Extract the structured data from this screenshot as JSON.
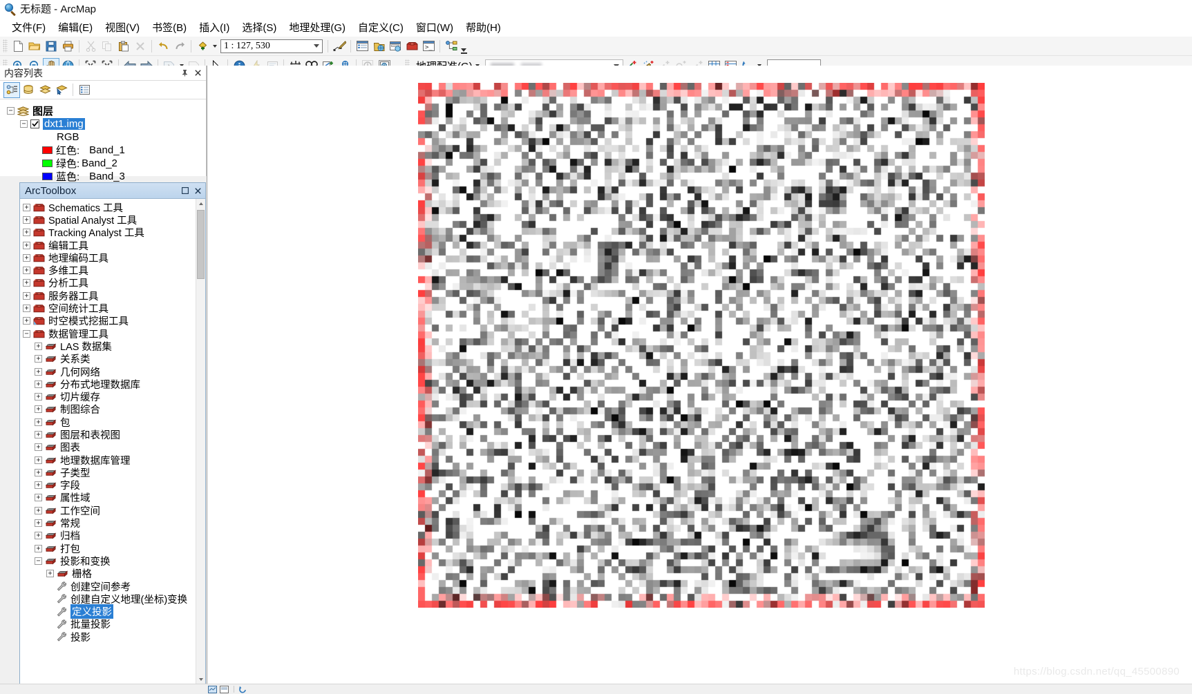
{
  "window": {
    "title": "无标题 - ArcMap",
    "app_icon": "arcmap-globe-icon"
  },
  "menu": {
    "items": [
      {
        "label": "文件(F)"
      },
      {
        "label": "编辑(E)"
      },
      {
        "label": "视图(V)"
      },
      {
        "label": "书签(B)"
      },
      {
        "label": "插入(I)"
      },
      {
        "label": "选择(S)"
      },
      {
        "label": "地理处理(G)"
      },
      {
        "label": "自定义(C)"
      },
      {
        "label": "窗口(W)"
      },
      {
        "label": "帮助(H)"
      }
    ]
  },
  "standard_toolbar": {
    "scale": "1 : 127, 530",
    "scale_placeholder": "1 : 127, 530",
    "buttons": [
      {
        "name": "new-map-icon",
        "tip": "新建地图文档"
      },
      {
        "name": "open-icon",
        "tip": "打开"
      },
      {
        "name": "save-icon",
        "tip": "保存"
      },
      {
        "name": "print-icon",
        "tip": "打印"
      },
      {
        "name": "cut-icon",
        "tip": "剪切"
      },
      {
        "name": "copy-icon",
        "tip": "复制"
      },
      {
        "name": "paste-icon",
        "tip": "粘贴"
      },
      {
        "name": "delete-icon",
        "tip": "删除"
      },
      {
        "name": "undo-icon",
        "tip": "撤销"
      },
      {
        "name": "redo-icon",
        "tip": "重做"
      },
      {
        "name": "add-data-icon",
        "tip": "添加数据"
      },
      {
        "name": "editor-toolbar-icon",
        "tip": "编辑器工具条"
      },
      {
        "name": "table-of-contents-icon",
        "tip": "内容列表"
      },
      {
        "name": "catalog-icon",
        "tip": "目录"
      },
      {
        "name": "search-window-icon",
        "tip": "搜索"
      },
      {
        "name": "arctoolbox-icon",
        "tip": "ArcToolbox"
      },
      {
        "name": "python-window-icon",
        "tip": "Python 窗口"
      },
      {
        "name": "model-builder-icon",
        "tip": "模型构建器"
      }
    ]
  },
  "tools_toolbar": {
    "buttons": [
      {
        "name": "zoom-in-icon",
        "tip": "放大"
      },
      {
        "name": "zoom-out-icon",
        "tip": "缩小"
      },
      {
        "name": "pan-icon",
        "tip": "平移",
        "active": true
      },
      {
        "name": "full-extent-icon",
        "tip": "全图范围"
      },
      {
        "name": "fixed-zoom-in-icon",
        "tip": "固定比例放大"
      },
      {
        "name": "fixed-zoom-out-icon",
        "tip": "固定比例缩小"
      },
      {
        "name": "go-back-icon",
        "tip": "返回上一视图"
      },
      {
        "name": "go-forward-icon",
        "tip": "前进至下一视图"
      },
      {
        "name": "select-features-icon",
        "tip": "选择要素"
      },
      {
        "name": "clear-selection-icon",
        "tip": "清除所选要素"
      },
      {
        "name": "select-elements-icon",
        "tip": "选择元素"
      },
      {
        "name": "identify-icon",
        "tip": "识别"
      },
      {
        "name": "hyperlink-icon",
        "tip": "超链接"
      },
      {
        "name": "html-popup-icon",
        "tip": "HTML 弹出窗口"
      },
      {
        "name": "measure-icon",
        "tip": "测量"
      },
      {
        "name": "find-icon",
        "tip": "查找"
      },
      {
        "name": "find-route-icon",
        "tip": "查找路径"
      },
      {
        "name": "go-to-xy-icon",
        "tip": "转到 XY"
      },
      {
        "name": "time-slider-icon",
        "tip": "时间滑块"
      },
      {
        "name": "create-viewer-icon",
        "tip": "创建视图窗口"
      }
    ]
  },
  "georeferencing_toolbar": {
    "menu_label": "地理配准(G)",
    "layer_value": "",
    "buttons": [
      {
        "name": "add-control-points-icon",
        "tip": "添加控制点"
      },
      {
        "name": "auto-register-icon",
        "tip": "自动配准"
      },
      {
        "name": "delete-control-point-icon",
        "tip": "删除控制点",
        "disabled": true
      },
      {
        "name": "zoom-to-link-icon",
        "tip": "缩放至链接",
        "disabled": true
      },
      {
        "name": "clear-links-icon",
        "tip": "清除链接",
        "disabled": true
      },
      {
        "name": "view-link-table-icon",
        "tip": "查看链接表"
      },
      {
        "name": "link-table-icon",
        "tip": "链接表"
      },
      {
        "name": "rotate-icon",
        "tip": "旋转"
      }
    ],
    "rotation_value": ""
  },
  "toc": {
    "title": "内容列表",
    "pin_icon": "pin-icon",
    "close_icon": "close-icon",
    "toolbar": [
      {
        "name": "list-by-drawing-order-icon",
        "active": true
      },
      {
        "name": "list-by-source-icon",
        "active": false
      },
      {
        "name": "list-by-visibility-icon",
        "active": false
      },
      {
        "name": "list-by-selection-icon",
        "active": false
      },
      {
        "name": "options-icon",
        "active": false
      }
    ],
    "root": {
      "label": "图层",
      "icon": "layers-icon"
    },
    "layer": {
      "label": "dxt1.img",
      "selected": true,
      "checked": true,
      "renderer": "RGB",
      "bands": [
        {
          "color_label": "红色:",
          "band": "Band_1",
          "color": "#ff0000"
        },
        {
          "color_label": "绿色:",
          "band": "Band_2",
          "color": "#00ff00"
        },
        {
          "color_label": "蓝色:",
          "band": "Band_3",
          "color": "#0000ff"
        }
      ]
    }
  },
  "arctoolbox": {
    "title": "ArcToolbox",
    "restore_icon": "restore-icon",
    "close_icon": "close-icon",
    "tree": [
      {
        "label": "Schematics 工具",
        "indent": 0,
        "expander": "+",
        "icon": "toolbox-icon"
      },
      {
        "label": "Spatial Analyst 工具",
        "indent": 0,
        "expander": "+",
        "icon": "toolbox-icon"
      },
      {
        "label": "Tracking Analyst 工具",
        "indent": 0,
        "expander": "+",
        "icon": "toolbox-icon"
      },
      {
        "label": "编辑工具",
        "indent": 0,
        "expander": "+",
        "icon": "toolbox-icon"
      },
      {
        "label": "地理编码工具",
        "indent": 0,
        "expander": "+",
        "icon": "toolbox-icon"
      },
      {
        "label": "多维工具",
        "indent": 0,
        "expander": "+",
        "icon": "toolbox-icon"
      },
      {
        "label": "分析工具",
        "indent": 0,
        "expander": "+",
        "icon": "toolbox-icon"
      },
      {
        "label": "服务器工具",
        "indent": 0,
        "expander": "+",
        "icon": "toolbox-icon"
      },
      {
        "label": "空间统计工具",
        "indent": 0,
        "expander": "+",
        "icon": "toolbox-icon"
      },
      {
        "label": "时空模式挖掘工具",
        "indent": 0,
        "expander": "+",
        "icon": "toolbox-blue-icon"
      },
      {
        "label": "数据管理工具",
        "indent": 0,
        "expander": "-",
        "icon": "toolbox-icon"
      },
      {
        "label": "LAS 数据集",
        "indent": 1,
        "expander": "+",
        "icon": "toolset-icon"
      },
      {
        "label": "关系类",
        "indent": 1,
        "expander": "+",
        "icon": "toolset-icon"
      },
      {
        "label": "几何网络",
        "indent": 1,
        "expander": "+",
        "icon": "toolset-icon"
      },
      {
        "label": "分布式地理数据库",
        "indent": 1,
        "expander": "+",
        "icon": "toolset-icon"
      },
      {
        "label": "切片缓存",
        "indent": 1,
        "expander": "+",
        "icon": "toolset-icon"
      },
      {
        "label": "制图综合",
        "indent": 1,
        "expander": "+",
        "icon": "toolset-icon"
      },
      {
        "label": "包",
        "indent": 1,
        "expander": "+",
        "icon": "toolset-icon"
      },
      {
        "label": "图层和表视图",
        "indent": 1,
        "expander": "+",
        "icon": "toolset-icon"
      },
      {
        "label": "图表",
        "indent": 1,
        "expander": "+",
        "icon": "toolset-icon"
      },
      {
        "label": "地理数据库管理",
        "indent": 1,
        "expander": "+",
        "icon": "toolset-icon"
      },
      {
        "label": "子类型",
        "indent": 1,
        "expander": "+",
        "icon": "toolset-icon"
      },
      {
        "label": "字段",
        "indent": 1,
        "expander": "+",
        "icon": "toolset-icon"
      },
      {
        "label": "属性域",
        "indent": 1,
        "expander": "+",
        "icon": "toolset-icon"
      },
      {
        "label": "工作空间",
        "indent": 1,
        "expander": "+",
        "icon": "toolset-icon"
      },
      {
        "label": "常规",
        "indent": 1,
        "expander": "+",
        "icon": "toolset-icon"
      },
      {
        "label": "归档",
        "indent": 1,
        "expander": "+",
        "icon": "toolset-icon"
      },
      {
        "label": "打包",
        "indent": 1,
        "expander": "+",
        "icon": "toolset-icon"
      },
      {
        "label": "投影和变换",
        "indent": 1,
        "expander": "-",
        "icon": "toolset-icon"
      },
      {
        "label": "栅格",
        "indent": 2,
        "expander": "+",
        "icon": "toolset-icon"
      },
      {
        "label": "创建空间参考",
        "indent": 2,
        "expander": "",
        "icon": "tool-icon"
      },
      {
        "label": "创建自定义地理(坐标)变换",
        "indent": 2,
        "expander": "",
        "icon": "tool-icon"
      },
      {
        "label": "定义投影",
        "indent": 2,
        "expander": "",
        "icon": "tool-icon",
        "selected": true
      },
      {
        "label": "批量投影",
        "indent": 2,
        "expander": "",
        "icon": "tool-icon"
      },
      {
        "label": "投影",
        "indent": 2,
        "expander": "",
        "icon": "tool-icon"
      }
    ]
  },
  "map": {
    "watermark": "https://blog.csdn.net/qq_45500890",
    "layer_name": "dxt1.img",
    "border_color": "#ff4444",
    "background": "#ffffff"
  },
  "status_bar": {
    "buttons": [
      {
        "name": "data-view-icon"
      },
      {
        "name": "layout-view-icon"
      },
      {
        "name": "refresh-icon"
      }
    ]
  }
}
